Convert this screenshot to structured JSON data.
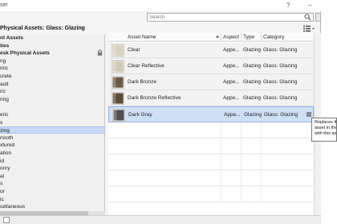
{
  "window": {
    "title": "ser",
    "help_glyph": "?",
    "minimize_glyph": "–"
  },
  "search": {
    "placeholder": "Search"
  },
  "breadcrumb": "Physical Assets: Glass: Glazing",
  "sidebar": {
    "items": [
      {
        "label": "nt Assets",
        "bold": true
      },
      {
        "label": "ites",
        "bold": true
      },
      {
        "label": "esk Physical Assets",
        "bold": true,
        "locked": true
      },
      {
        "label": "ng"
      },
      {
        "label": "mic"
      },
      {
        "label": "crete"
      },
      {
        "label": "ault"
      },
      {
        "label": "ric"
      },
      {
        "label": "ring"
      },
      {
        "label": ""
      },
      {
        "label": "eric"
      },
      {
        "label": "s"
      },
      {
        "label": "zing",
        "selected": true
      },
      {
        "label": "nooth"
      },
      {
        "label": "xtured"
      },
      {
        "label": "ation"
      },
      {
        "label": "id"
      },
      {
        "label": "onry"
      },
      {
        "label": "al"
      },
      {
        "label": "s"
      },
      {
        "label": "or"
      },
      {
        "label": "ic"
      },
      {
        "label": "cellaneous"
      }
    ]
  },
  "table": {
    "columns": [
      "Asset Name",
      "Aspect",
      "Type",
      "Category"
    ],
    "rows": [
      {
        "name": "Clear",
        "aspect": "Appe...",
        "type": "Glazing",
        "category": "Glass: Glazing",
        "swatch": "#d7d2c4"
      },
      {
        "name": "Clear Reflective",
        "aspect": "Appe...",
        "type": "Glazing",
        "category": "Glass: Glazing",
        "swatch": "#cfc9b8"
      },
      {
        "name": "Dark Bronze",
        "aspect": "Appe...",
        "type": "Glazing",
        "category": "Glass: Glazing",
        "swatch": "#6b5a44"
      },
      {
        "name": "Dark Bronze Reflective",
        "aspect": "Appe...",
        "type": "Glazing",
        "category": "Glass: Glazing",
        "swatch": "#5a4a38"
      },
      {
        "name": "Dark Gray",
        "aspect": "Appe...",
        "type": "Glazing",
        "category": "Glass: Glazing",
        "swatch": "#4d4f52",
        "selected": true
      }
    ]
  },
  "tooltip": {
    "lines": [
      "Replaces th",
      "asset in the",
      "with this as"
    ]
  },
  "colors": {
    "selection": "#cfdff6",
    "selection_border": "#8fb2e3",
    "sidebar_selection": "#c6d8f4"
  }
}
